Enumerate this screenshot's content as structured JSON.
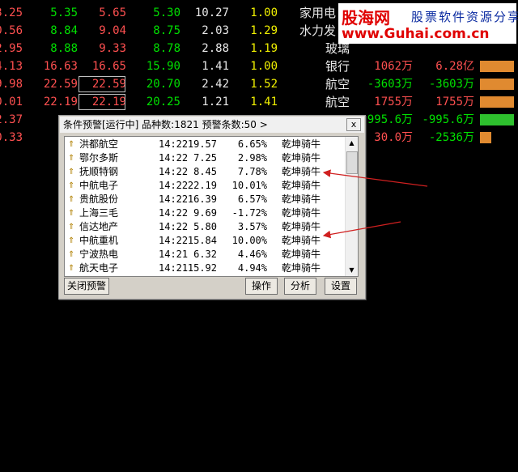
{
  "quote_rows": [
    {
      "c1": "3.25",
      "c1_color": "red",
      "c2": "5.35",
      "c2_color": "green",
      "c3": "5.65",
      "c3_color": "red",
      "c3_boxed": false,
      "c4": "5.30",
      "c4_color": "green",
      "c5": "10.27",
      "c6": "1.00",
      "c6_color": "yellow",
      "name": "家用电"
    },
    {
      "c1": "0.56",
      "c1_color": "red",
      "c2": "8.84",
      "c2_color": "green",
      "c3": "9.04",
      "c3_color": "red",
      "c3_boxed": false,
      "c4": "8.75",
      "c4_color": "green",
      "c5": "2.03",
      "c6": "1.29",
      "c6_color": "yellow",
      "name": "水力发"
    },
    {
      "c1": "2.95",
      "c1_color": "red",
      "c2": "8.88",
      "c2_color": "green",
      "c3": "9.33",
      "c3_color": "red",
      "c3_boxed": false,
      "c4": "8.78",
      "c4_color": "green",
      "c5": "2.88",
      "c6": "1.19",
      "c6_color": "yellow",
      "name": "玻璃"
    },
    {
      "c1": "4.13",
      "c1_color": "red",
      "c2": "16.63",
      "c2_color": "red",
      "c3": "16.65",
      "c3_color": "red",
      "c3_boxed": false,
      "c4": "15.90",
      "c4_color": "green",
      "c5": "1.41",
      "c6": "1.00",
      "c6_color": "yellow",
      "name": "银行",
      "vol": "1062万",
      "vol_color": "red",
      "amt": "6.28亿",
      "amt_color": "red",
      "bar_frac": 0.9,
      "bar_color": "#e08a30"
    },
    {
      "c1": "9.98",
      "c1_color": "red",
      "c2": "22.59",
      "c2_color": "red",
      "c3": "22.59",
      "c3_color": "red",
      "c3_boxed": true,
      "c4": "20.70",
      "c4_color": "green",
      "c5": "2.42",
      "c6": "1.52",
      "c6_color": "yellow",
      "name": "航空",
      "vol": "-3603万",
      "vol_color": "green",
      "amt": "-3603万",
      "amt_color": "green",
      "bar_frac": 0.9,
      "bar_color": "#e08a30"
    },
    {
      "c1": "0.01",
      "c1_color": "red",
      "c2": "22.19",
      "c2_color": "red",
      "c3": "22.19",
      "c3_color": "red",
      "c3_boxed": true,
      "c4": "20.25",
      "c4_color": "green",
      "c5": "1.21",
      "c6": "1.41",
      "c6_color": "yellow",
      "name": "航空",
      "vol": "1755万",
      "vol_color": "red",
      "amt": "1755万",
      "amt_color": "red",
      "bar_frac": 0.9,
      "bar_color": "#e08a30"
    },
    {
      "c1": "2.37",
      "c1_color": "red",
      "c2": "",
      "c2_color": "red",
      "c3": "",
      "c3_color": "red",
      "c3_boxed": false,
      "c4": "",
      "c4_color": "green",
      "c5": "",
      "c6": "",
      "c6_color": "yellow",
      "name": "",
      "vol": "-995.6万",
      "vol_color": "green",
      "amt": "-995.6万",
      "amt_color": "green",
      "bar_frac": 0.9,
      "bar_color": "#2ec02e"
    },
    {
      "c1": "0.33",
      "c1_color": "red",
      "c2": "",
      "c2_color": "red",
      "c3": "",
      "c3_color": "red",
      "c3_boxed": false,
      "c4": "",
      "c4_color": "green",
      "c5": "",
      "c6": "",
      "c6_color": "yellow",
      "name": "",
      "vol": "30.0万",
      "vol_color": "red",
      "amt": "-2536万",
      "amt_color": "green",
      "bar_frac": 0.3,
      "bar_color": "#e08a30"
    }
  ],
  "logo": {
    "title": "股海网",
    "subtitle": "股票软件资源分享",
    "url": "www.Guhai.com.cn"
  },
  "dialog": {
    "title": "条件预警[运行中] 品种数:1821 预警条数:50  >",
    "close_label": "x",
    "rows": [
      {
        "name": "洪都航空",
        "time": "14:22",
        "price": "19.57",
        "pct": "6.65%",
        "cond": "乾坤骑牛"
      },
      {
        "name": "鄂尔多斯",
        "time": "14:22",
        "price": "7.25",
        "pct": "2.98%",
        "cond": "乾坤骑牛"
      },
      {
        "name": "抚顺特钢",
        "time": "14:22",
        "price": "8.45",
        "pct": "7.78%",
        "cond": "乾坤骑牛"
      },
      {
        "name": "中航电子",
        "time": "14:22",
        "price": "22.19",
        "pct": "10.01%",
        "cond": "乾坤骑牛"
      },
      {
        "name": "贵航股份",
        "time": "14:22",
        "price": "16.39",
        "pct": "6.57%",
        "cond": "乾坤骑牛"
      },
      {
        "name": "上海三毛",
        "time": "14:22",
        "price": "9.69",
        "pct": "-1.72%",
        "cond": "乾坤骑牛"
      },
      {
        "name": "信达地产",
        "time": "14:22",
        "price": "5.80",
        "pct": "3.57%",
        "cond": "乾坤骑牛"
      },
      {
        "name": "中航重机",
        "time": "14:22",
        "price": "15.84",
        "pct": "10.00%",
        "cond": "乾坤骑牛"
      },
      {
        "name": "宁波热电",
        "time": "14:21",
        "price": "6.32",
        "pct": "4.46%",
        "cond": "乾坤骑牛"
      },
      {
        "name": "航天电子",
        "time": "14:21",
        "price": "15.92",
        "pct": "4.94%",
        "cond": "乾坤骑牛"
      }
    ],
    "buttons": {
      "close_alert": "关闭预警",
      "operate": "操作",
      "analyze": "分析",
      "settings": "设置"
    }
  },
  "colors": {
    "red": "#ff5050",
    "green": "#00e000",
    "yellow": "#f0f000",
    "background": "#000000"
  }
}
